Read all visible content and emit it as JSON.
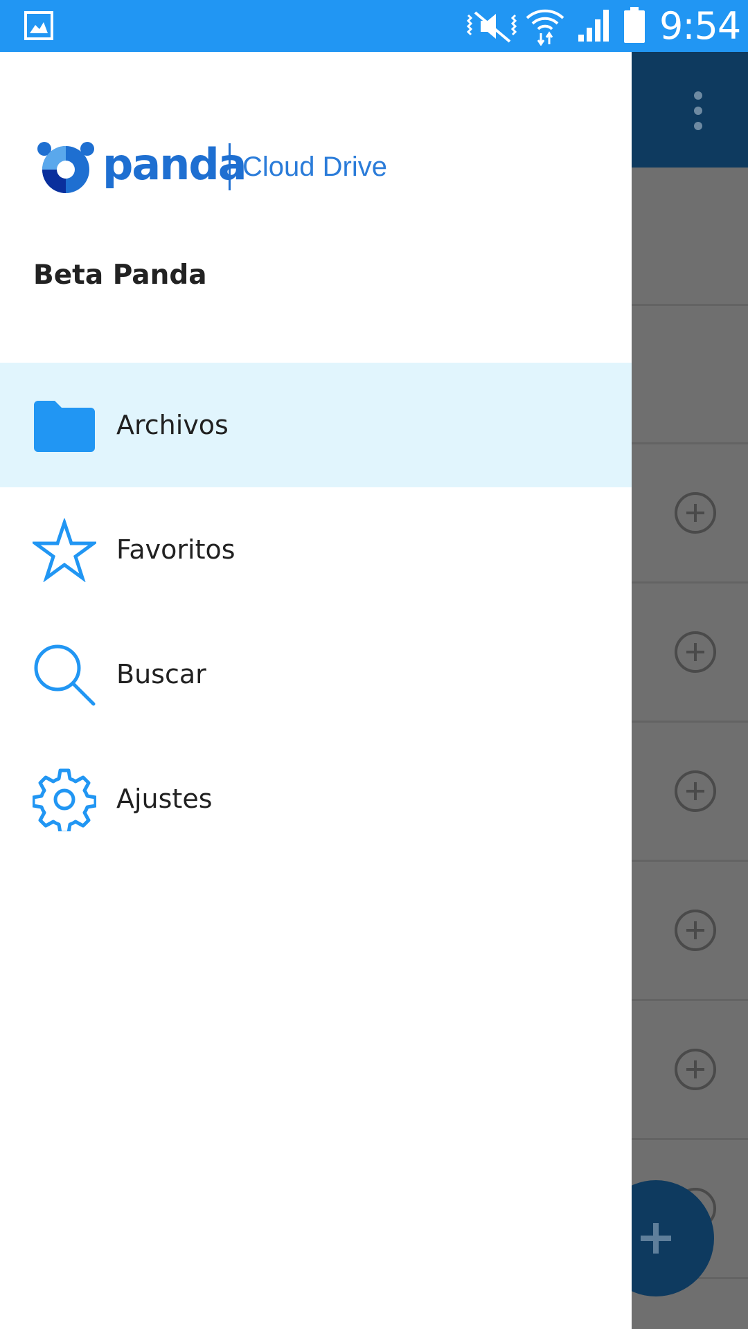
{
  "status_bar": {
    "time": "9:54",
    "icons": [
      "gallery-icon",
      "vibrate-mute-icon",
      "wifi-icon",
      "signal-icon",
      "battery-icon"
    ]
  },
  "drawer": {
    "logo": {
      "brand": "panda",
      "product": "Cloud Drive"
    },
    "user_name": "Beta Panda",
    "items": [
      {
        "label": "Archivos",
        "icon": "folder-icon",
        "active": true
      },
      {
        "label": "Favoritos",
        "icon": "star-icon",
        "active": false
      },
      {
        "label": "Buscar",
        "icon": "search-icon",
        "active": false
      },
      {
        "label": "Ajustes",
        "icon": "gear-icon",
        "active": false
      }
    ]
  },
  "colors": {
    "status_bar": "#2196f3",
    "accent": "#2196f3",
    "active_item_bg": "#e1f5fd",
    "toolbar_dimmed": "#0e3a5f",
    "brand_blue": "#1e6fd1"
  }
}
